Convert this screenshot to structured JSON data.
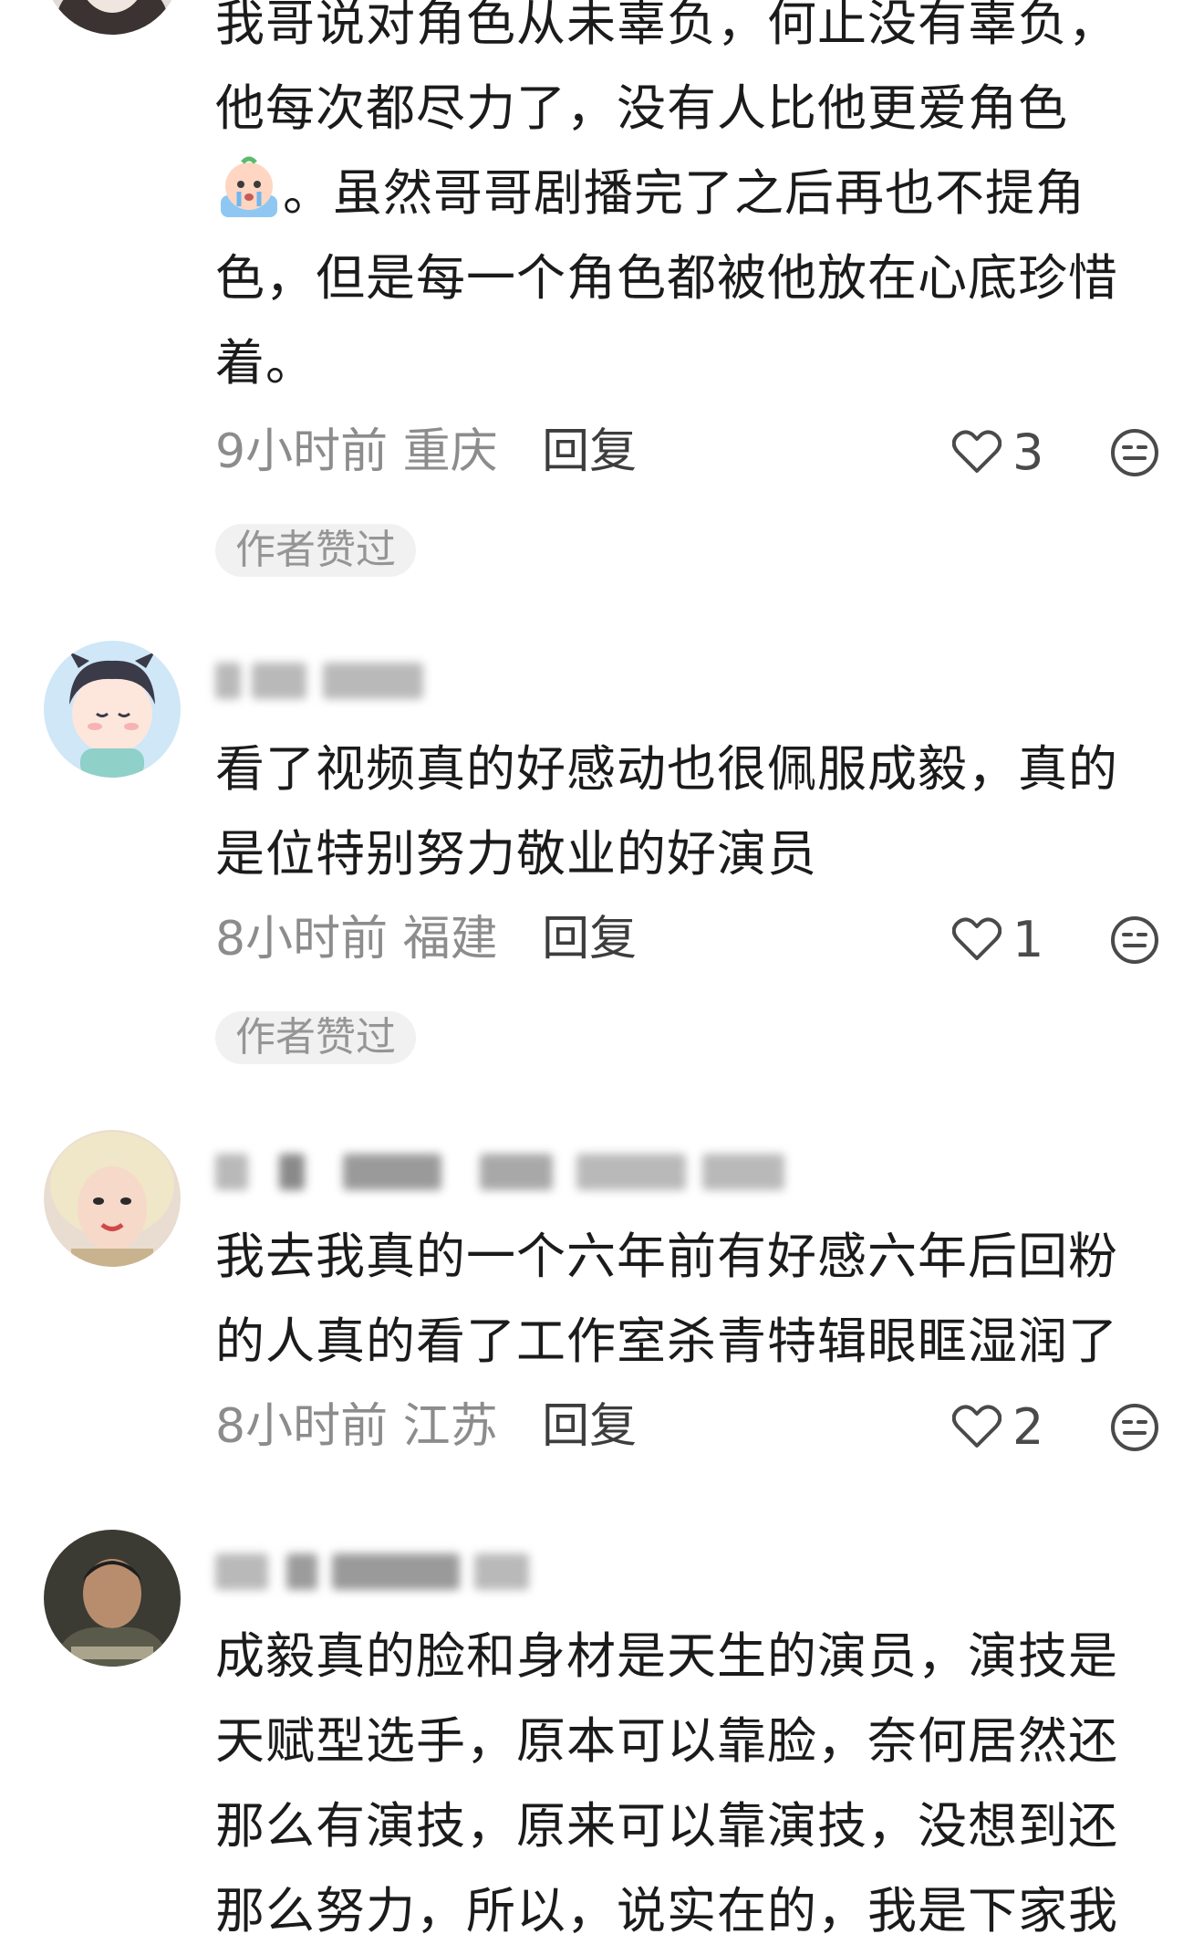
{
  "comments": [
    {
      "lines": [
        "我哥说对角色从未辜负，何止没有辜负，",
        "他每次都尽力了，没有人比他更爱角色"
      ],
      "emoji": "crying-emoji",
      "lines_after": [
        "。虽然哥哥剧播完了之后再也不提角",
        "色，但是每一个角色都被他放在心底珍惜",
        "着。"
      ],
      "time": "9小时前",
      "location": "重庆",
      "reply": "回复",
      "likes": "3",
      "badge": "作者赞过"
    },
    {
      "lines": [
        "看了视频真的好感动也很佩服成毅，真的",
        "是位特别努力敬业的好演员"
      ],
      "time": "8小时前",
      "location": "福建",
      "reply": "回复",
      "likes": "1",
      "badge": "作者赞过"
    },
    {
      "lines": [
        "我去我真的一个六年前有好感六年后回粉",
        "的人真的看了工作室杀青特辑眼眶湿润了"
      ],
      "time": "8小时前",
      "location": "江苏",
      "reply": "回复",
      "likes": "2"
    },
    {
      "lines": [
        "成毅真的脸和身材是天生的演员，演技是",
        "天赋型选手，原本可以靠脸，奈何居然还",
        "那么有演技，原来可以靠演技，没想到还",
        "那么努力，所以，说实在的，我是下家我"
      ]
    }
  ],
  "icons": {
    "like": "heart-outline-icon",
    "emoji": "smile-face-icon"
  },
  "colors": {
    "text": "#1b1b1b",
    "meta": "#8c8c8c",
    "badge_bg": "#f1f1f1"
  }
}
